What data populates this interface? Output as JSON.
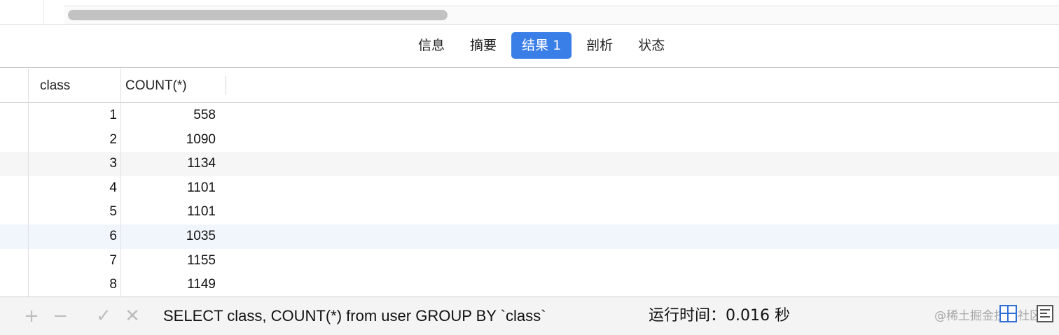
{
  "tabs": [
    {
      "label": "信息",
      "active": false
    },
    {
      "label": "摘要",
      "active": false
    },
    {
      "label": "结果 1",
      "active": true
    },
    {
      "label": "剖析",
      "active": false
    },
    {
      "label": "状态",
      "active": false
    }
  ],
  "table": {
    "columns": [
      "class",
      "COUNT(*)"
    ],
    "rows": [
      [
        "1",
        "558"
      ],
      [
        "2",
        "1090"
      ],
      [
        "3",
        "1134"
      ],
      [
        "4",
        "1101"
      ],
      [
        "5",
        "1101"
      ],
      [
        "6",
        "1035"
      ],
      [
        "7",
        "1155"
      ],
      [
        "8",
        "1149"
      ]
    ]
  },
  "statusbar": {
    "add_label": "+",
    "remove_label": "−",
    "apply_label": "✓",
    "discard_label": "✕",
    "sql": "SELECT class, COUNT(*) from user GROUP BY `class`",
    "runtime_label": "运行时间：",
    "runtime_value": "0.016 秒",
    "watermark": "@稀土掘金技术社区"
  },
  "colors": {
    "accent": "#3a7ee8",
    "highlight_row": "#f1f6fd"
  }
}
